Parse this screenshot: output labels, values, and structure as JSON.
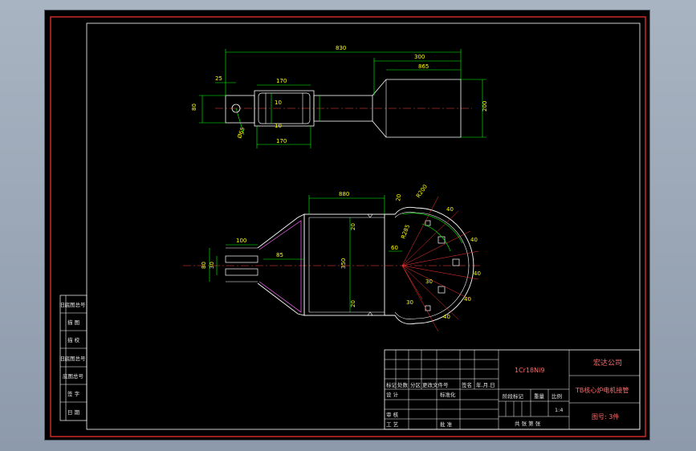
{
  "top_view": {
    "dims": {
      "overall": "830",
      "shaft_len": "300",
      "head_len": "865",
      "left_offset": "25",
      "bearing_width_top": "170",
      "bearing_width_bottom": "170",
      "height_left": "80",
      "height_right": "200",
      "inner_10_a": "10",
      "inner_10_b": "10",
      "hole": "Ø65"
    }
  },
  "front_view": {
    "dims": {
      "top_width": "880",
      "offset_20_top": "20",
      "offset_20_mid": "20",
      "offset_20_bottom": "20",
      "vertical_main": "350",
      "left_100": "100",
      "left_85": "85",
      "left_80": "80",
      "left_30": "30",
      "r_60": "60",
      "r_200": "R200",
      "r_285": "R285",
      "r_30": "30",
      "angle_a": "40",
      "angle_b": "40",
      "angle_c": "40",
      "angle_d": "40",
      "angle_e": "40",
      "angle_f": "30"
    }
  },
  "side_table": {
    "rows": [
      "旧底图总号",
      "描 图",
      "描 校",
      "旧底图总号",
      "底图总号",
      "签 字",
      "日 期"
    ]
  },
  "title_block": {
    "material": "1Cr18Ni9",
    "company": "宏达公司",
    "part_name": "TB核心炉电机接管",
    "drawing_no": "图号: 3件",
    "col_marks": "标记",
    "col_count": "处数",
    "col_zone": "分区",
    "col_docno": "更改文件号",
    "col_sign": "签名",
    "col_date": "年.月.日",
    "design": "设 计",
    "standard": "标准化",
    "stage_mark": "阶段标记",
    "weight": "重量",
    "scale": "比例",
    "scale_val": "1:4",
    "review": "审 核",
    "process": "工 艺",
    "approve": "批 准",
    "sheets": "共  张  第  张"
  }
}
